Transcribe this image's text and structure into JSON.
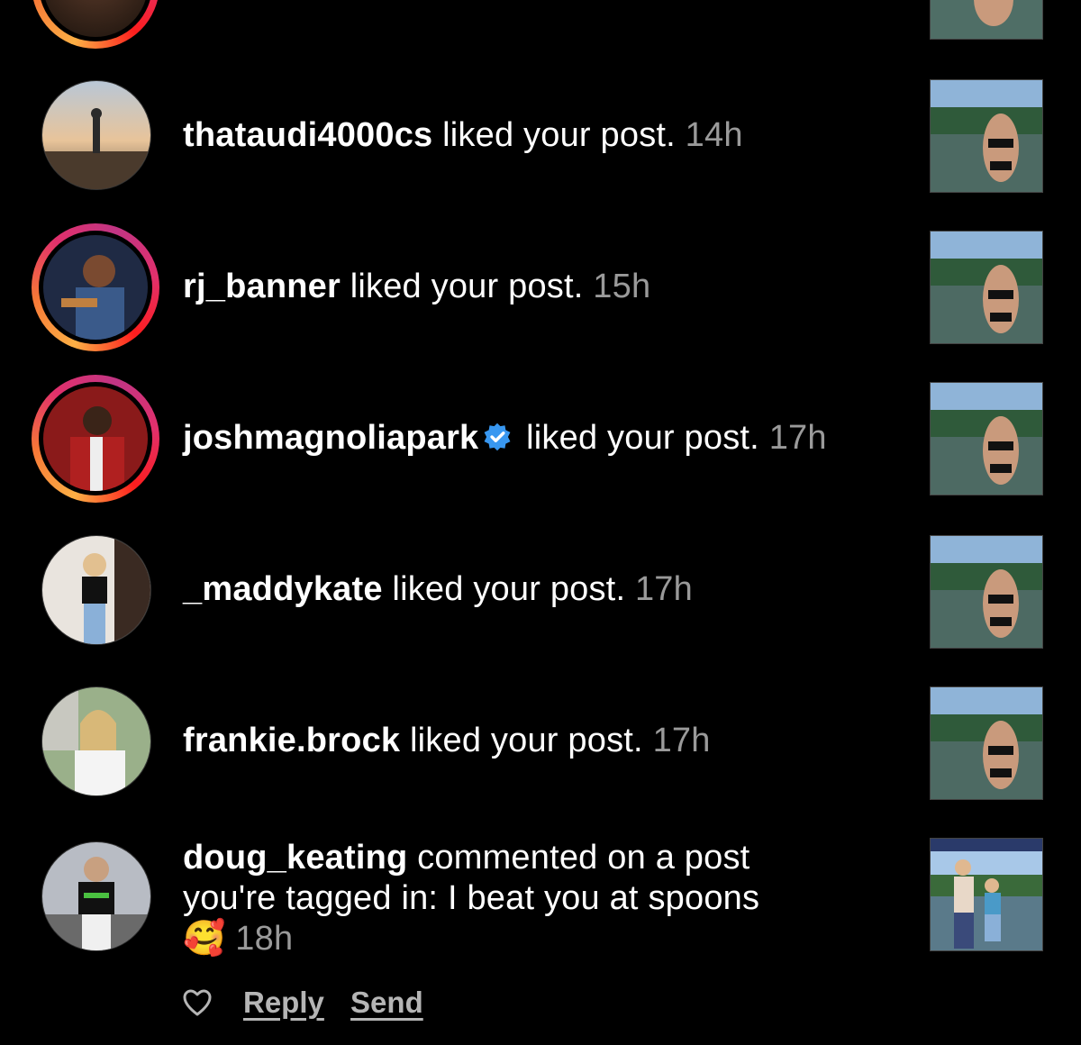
{
  "notifications": [
    {
      "username": "thataudi4000cs",
      "action": " liked your post. ",
      "time": "14h",
      "ring": false,
      "verified": false
    },
    {
      "username": "rj_banner",
      "action": " liked your post. ",
      "time": "15h",
      "ring": true,
      "verified": false
    },
    {
      "username": "joshmagnoliapark",
      "action": " liked your post. ",
      "time": "17h",
      "ring": true,
      "verified": true
    },
    {
      "username": "_maddykate",
      "action": " liked your post. ",
      "time": "17h",
      "ring": false,
      "verified": false
    },
    {
      "username": "frankie.brock",
      "action": " liked your post. ",
      "time": "17h",
      "ring": false,
      "verified": false
    }
  ],
  "comment": {
    "username": "doug_keating",
    "line1": " commented on a post",
    "line2": "you're tagged in: I beat you at spoons",
    "emoji": "🥰",
    "time": "18h"
  },
  "actions": {
    "reply": "Reply",
    "send": "Send"
  },
  "colors": {
    "ring_start": "#fcaf45",
    "ring_end": "#c13584",
    "verified": "#3897f0",
    "muted": "#9a9a9a"
  }
}
